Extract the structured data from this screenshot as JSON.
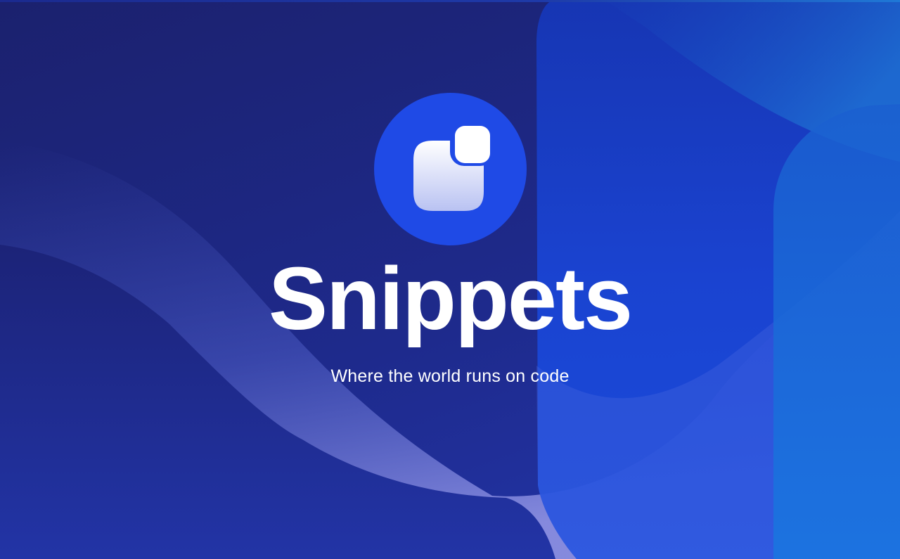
{
  "splash": {
    "app_name": "Snippets",
    "tagline": "Where the world runs on code",
    "logo_icon": "snippets-logo-icon"
  },
  "colors": {
    "background_dark": "#1b216e",
    "background_mid": "#1e2a8c",
    "panel_blue": "#1a47d8",
    "panel_light_blue": "#1a73dc",
    "logo_circle": "#1f4ae6",
    "text": "#ffffff"
  }
}
